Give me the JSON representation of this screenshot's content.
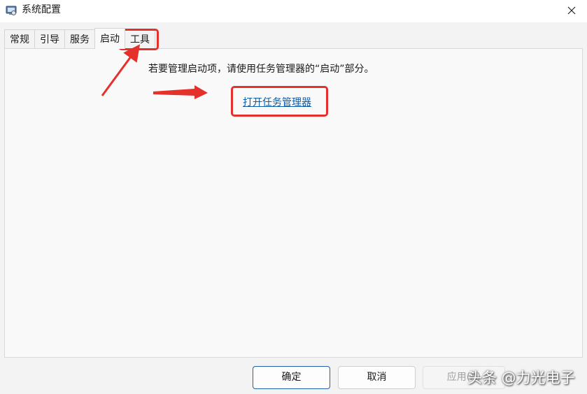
{
  "window": {
    "title": "系统配置"
  },
  "tabs": [
    {
      "label": "常规"
    },
    {
      "label": "引导"
    },
    {
      "label": "服务"
    },
    {
      "label": "启动",
      "active": true
    },
    {
      "label": "工具"
    }
  ],
  "startup": {
    "instruction": "若要管理启动项，请使用任务管理器的“启动”部分。",
    "link_label": "打开任务管理器"
  },
  "buttons": {
    "ok": "确定",
    "cancel": "取消",
    "apply": "应用(A)"
  },
  "watermark": "头条 @力光电子",
  "colors": {
    "annotation": "#e5312b",
    "link": "#0b5cad",
    "primary_border": "#1f5fae"
  },
  "icons": {
    "app": "msconfig-icon",
    "close": "close-icon"
  }
}
